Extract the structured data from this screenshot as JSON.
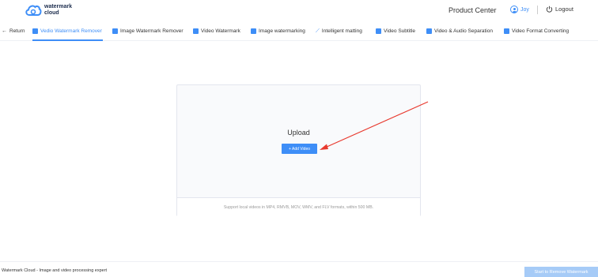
{
  "header": {
    "logo_line1": "watermark",
    "logo_line2": "cloud",
    "product_center": "Product Center",
    "user_name": "Joy",
    "logout": "Logout"
  },
  "nav": {
    "return": "Return",
    "items": [
      {
        "label": "Vedio Watermark Remover",
        "active": true
      },
      {
        "label": "Image Watermark Remover"
      },
      {
        "label": "Video Watermark"
      },
      {
        "label": "Image watermarking"
      },
      {
        "label": "Intelligent matting"
      },
      {
        "label": "Video Subtitle"
      },
      {
        "label": "Video & Audio Separation"
      },
      {
        "label": "Video Format Converting"
      }
    ]
  },
  "upload": {
    "title": "Upload",
    "add_button": "+ Add Video",
    "support_text": "Support local videos in MP4, RMVB, MOV, WMV, and FLV formats,  within 500 MB."
  },
  "footer": {
    "text": "Watermark Cloud - Image and video processing expert",
    "start_button": "Start to Remove Watermark"
  },
  "colors": {
    "accent": "#3e8ef7",
    "arrow": "#e8392e",
    "disabled_button": "#a6cbf7"
  }
}
